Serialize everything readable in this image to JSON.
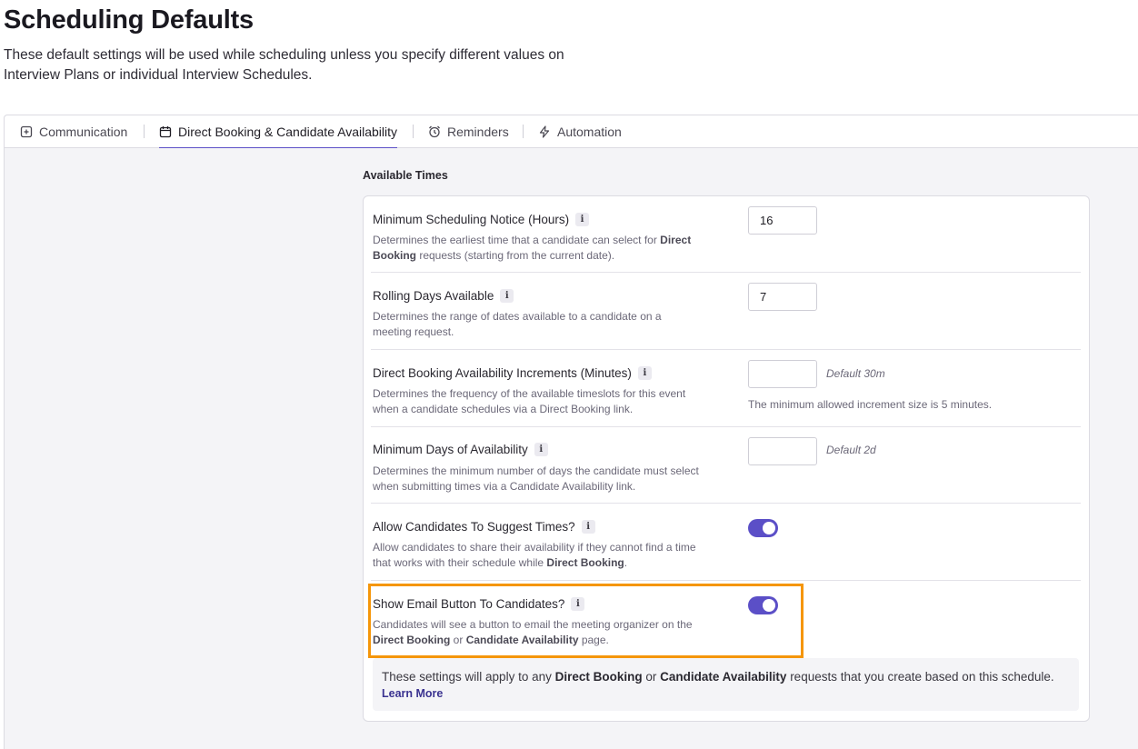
{
  "page": {
    "title": "Scheduling Defaults",
    "description": "These default settings will be used while scheduling unless you specify different values on Interview Plans or individual Interview Schedules."
  },
  "tabs": [
    {
      "label": "Communication",
      "icon": "message-icon",
      "active": false
    },
    {
      "label": "Direct Booking & Candidate Availability",
      "icon": "calendar-icon",
      "active": true
    },
    {
      "label": "Reminders",
      "icon": "alarm-clock-icon",
      "active": false
    },
    {
      "label": "Automation",
      "icon": "lightning-icon",
      "active": false
    }
  ],
  "section": {
    "title": "Available Times"
  },
  "settings": {
    "min_notice": {
      "label": "Minimum Scheduling Notice (Hours)",
      "desc_pre": "Determines the earliest time that a candidate can select for ",
      "desc_bold": "Direct Booking",
      "desc_post": " requests (starting from the current date).",
      "value": "16"
    },
    "rolling_days": {
      "label": "Rolling Days Available",
      "desc": "Determines the range of dates available to a candidate on a meeting request.",
      "value": "7"
    },
    "increments": {
      "label": "Direct Booking Availability Increments (Minutes)",
      "desc": "Determines the frequency of the available timeslots for this event when a candidate schedules via a Direct Booking link.",
      "value": "",
      "default_hint": "Default 30m",
      "note": "The minimum allowed increment size is 5 minutes."
    },
    "min_days": {
      "label": "Minimum Days of Availability",
      "desc": "Determines the minimum number of days the candidate must select when submitting times via a Candidate Availability link.",
      "value": "",
      "default_hint": "Default 2d"
    },
    "suggest_times": {
      "label": "Allow Candidates To Suggest Times?",
      "desc_pre": "Allow candidates to share their availability if they cannot find a time that works with their schedule while ",
      "desc_bold": "Direct Booking",
      "desc_post": ".",
      "enabled": true
    },
    "email_button": {
      "label": "Show Email Button To Candidates?",
      "desc_pre": "Candidates will see a button to email the meeting organizer on the ",
      "desc_bold1": "Direct Booking",
      "desc_mid": " or ",
      "desc_bold2": "Candidate Availability",
      "desc_post": " page.",
      "enabled": true
    }
  },
  "info_note": {
    "pre": "These settings will apply to any ",
    "bold1": "Direct Booking",
    "mid": " or ",
    "bold2": "Candidate Availability",
    "post": " requests that you create based on this schedule.",
    "link": "Learn More"
  },
  "colors": {
    "accent": "#5b4fc7",
    "highlight": "#f5960a",
    "link": "#3a3290"
  }
}
